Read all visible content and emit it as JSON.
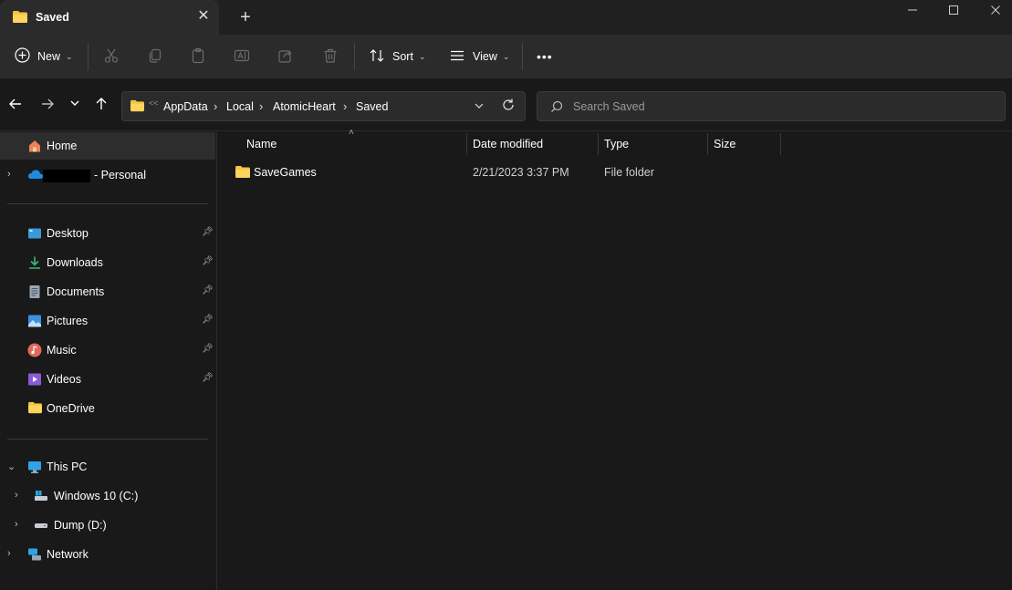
{
  "tab": {
    "title": "Saved",
    "close": "✕",
    "new_tab": "+"
  },
  "window_controls": {
    "minimize": "minimize",
    "maximize": "maximize",
    "close": "close"
  },
  "toolbar": {
    "new_label": "New",
    "sort_label": "Sort",
    "view_label": "View",
    "more": "•••",
    "icons": [
      "cut-icon",
      "copy-icon",
      "paste-icon",
      "rename-icon",
      "share-icon",
      "delete-icon"
    ]
  },
  "address": {
    "overflow": "<<",
    "crumbs": [
      "AppData",
      "Local",
      "AtomicHeart",
      "Saved"
    ]
  },
  "search": {
    "placeholder": "Search Saved"
  },
  "sidebar": {
    "home": "Home",
    "onedrive_personal": "- Personal",
    "quick_access": [
      {
        "label": "Desktop",
        "pinned": true
      },
      {
        "label": "Downloads",
        "pinned": true
      },
      {
        "label": "Documents",
        "pinned": true
      },
      {
        "label": "Pictures",
        "pinned": true
      },
      {
        "label": "Music",
        "pinned": true
      },
      {
        "label": "Videos",
        "pinned": true
      },
      {
        "label": "OneDrive",
        "pinned": false
      }
    ],
    "this_pc": "This PC",
    "drives": [
      "Windows 10 (C:)",
      "Dump (D:)"
    ],
    "network": "Network"
  },
  "columns": {
    "name": "Name",
    "date": "Date modified",
    "type": "Type",
    "size": "Size"
  },
  "files": [
    {
      "name": "SaveGames",
      "date": "2/21/2023 3:37 PM",
      "type": "File folder",
      "size": ""
    }
  ],
  "colors": {
    "folder": "#f5c342",
    "accent": "#4cc2ff",
    "background": "#191919"
  }
}
